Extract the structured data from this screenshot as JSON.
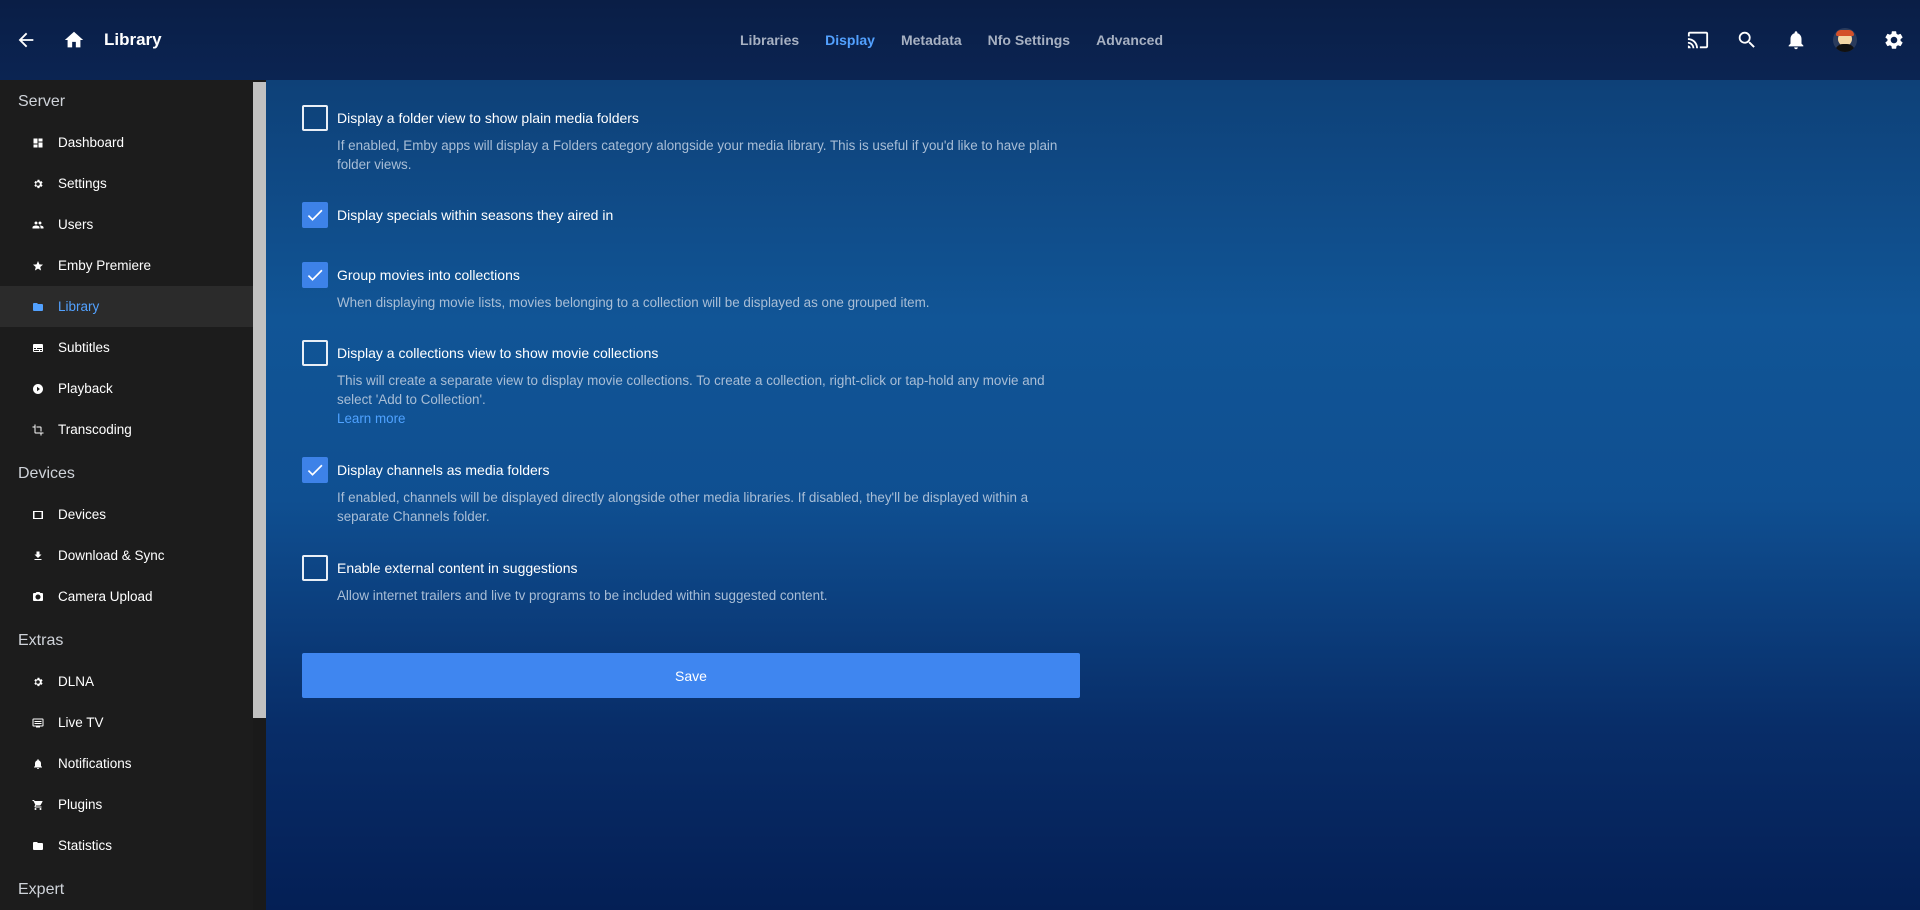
{
  "header": {
    "title": "Library",
    "tabs": [
      {
        "label": "Libraries",
        "active": false
      },
      {
        "label": "Display",
        "active": true
      },
      {
        "label": "Metadata",
        "active": false
      },
      {
        "label": "Nfo Settings",
        "active": false
      },
      {
        "label": "Advanced",
        "active": false
      }
    ],
    "accent_color": "#52a1ff"
  },
  "sidebar": {
    "sections": [
      {
        "title": "Server",
        "items": [
          {
            "label": "Dashboard",
            "icon": "dashboard-icon"
          },
          {
            "label": "Settings",
            "icon": "gear-icon"
          },
          {
            "label": "Users",
            "icon": "users-icon"
          },
          {
            "label": "Emby Premiere",
            "icon": "star-icon"
          },
          {
            "label": "Library",
            "icon": "folder-icon",
            "active": true
          },
          {
            "label": "Subtitles",
            "icon": "subtitles-icon"
          },
          {
            "label": "Playback",
            "icon": "play-circle-icon"
          },
          {
            "label": "Transcoding",
            "icon": "transcode-icon"
          }
        ]
      },
      {
        "title": "Devices",
        "items": [
          {
            "label": "Devices",
            "icon": "device-icon"
          },
          {
            "label": "Download & Sync",
            "icon": "download-icon"
          },
          {
            "label": "Camera Upload",
            "icon": "camera-icon"
          }
        ]
      },
      {
        "title": "Extras",
        "items": [
          {
            "label": "DLNA",
            "icon": "gear-icon"
          },
          {
            "label": "Live TV",
            "icon": "tv-icon"
          },
          {
            "label": "Notifications",
            "icon": "bell-icon"
          },
          {
            "label": "Plugins",
            "icon": "plugin-icon"
          },
          {
            "label": "Statistics",
            "icon": "folder-icon"
          }
        ]
      },
      {
        "title": "Expert",
        "items": []
      }
    ]
  },
  "options": [
    {
      "label": "Display a folder view to show plain media folders",
      "checked": false,
      "desc": "If enabled, Emby apps will display a Folders category alongside your media library. This is useful if you'd like to have plain folder views."
    },
    {
      "label": "Display specials within seasons they aired in",
      "checked": true,
      "desc": ""
    },
    {
      "label": "Group movies into collections",
      "checked": true,
      "desc": "When displaying movie lists, movies belonging to a collection will be displayed as one grouped item."
    },
    {
      "label": "Display a collections view to show movie collections",
      "checked": false,
      "desc": "This will create a separate view to display movie collections. To create a collection, right-click or tap-hold any movie and select 'Add to Collection'.",
      "link": "Learn more"
    },
    {
      "label": "Display channels as media folders",
      "checked": true,
      "desc": "If enabled, channels will be displayed directly alongside other media libraries. If disabled, they'll be displayed within a separate Channels folder."
    },
    {
      "label": "Enable external content in suggestions",
      "checked": false,
      "desc": "Allow internet trailers and live tv programs to be included within suggested content."
    }
  ],
  "save_label": "Save",
  "colors": {
    "checkbox_checked": "#3d82e8",
    "save_button": "#3f86f0",
    "sidebar_bg": "#1c1c1c"
  }
}
